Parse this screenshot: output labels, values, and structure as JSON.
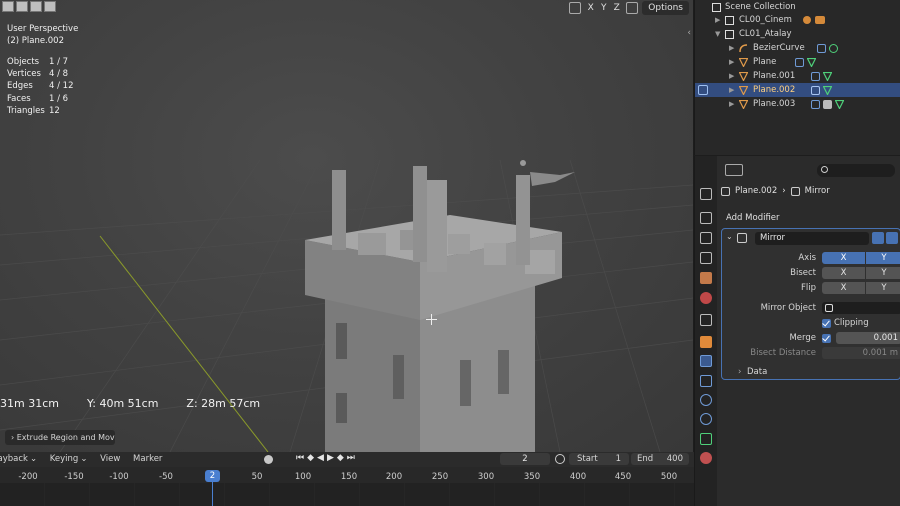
{
  "viewport": {
    "view_name": "User Perspective",
    "object_name": "(2) Plane.002",
    "stats": [
      {
        "label": "Objects",
        "value": "1 / 7"
      },
      {
        "label": "Vertices",
        "value": "4 / 8"
      },
      {
        "label": "Edges",
        "value": "4 / 12"
      },
      {
        "label": "Faces",
        "value": "1 / 6"
      },
      {
        "label": "Triangles",
        "value": "12"
      }
    ],
    "axes": [
      "X",
      "Y",
      "Z"
    ],
    "options_label": "Options",
    "coords": {
      "x": "31m 31cm",
      "y": "Y: 40m 51cm",
      "z": "Z: 28m 57cm"
    },
    "operator_panel": "Extrude Region and Mov"
  },
  "timeline": {
    "menu": [
      "Playback",
      "Keying",
      "View",
      "Marker"
    ],
    "current_frame": "2",
    "start_label": "Start",
    "start_value": "1",
    "end_label": "End",
    "end_value": "400",
    "ticks": [
      "-200",
      "-150",
      "-100",
      "-50",
      "2",
      "50",
      "100",
      "150",
      "200",
      "250",
      "300",
      "350",
      "400",
      "450",
      "500"
    ]
  },
  "outliner": {
    "items": [
      {
        "label": "Scene Collection",
        "icon": "collection-icon"
      },
      {
        "label": "CL00_Cinem",
        "icon": "collection-icon"
      },
      {
        "label": "CL01_Atalay",
        "icon": "collection-icon"
      },
      {
        "label": "BezierCurve",
        "icon": "curve-icon"
      },
      {
        "label": "Plane",
        "icon": "mesh-icon"
      },
      {
        "label": "Plane.001",
        "icon": "mesh-icon"
      },
      {
        "label": "Plane.002",
        "icon": "mesh-icon",
        "selected": true
      },
      {
        "label": "Plane.003",
        "icon": "mesh-icon"
      }
    ]
  },
  "properties": {
    "breadcrumb_object": "Plane.002",
    "breadcrumb_modifier": "Mirror",
    "add_modifier": "Add Modifier",
    "modifier_name": "Mirror",
    "axis_label": "Axis",
    "bisect_label": "Bisect",
    "flip_label": "Flip",
    "x": "X",
    "y": "Y",
    "mirror_object_label": "Mirror Object",
    "clipping_label": "Clipping",
    "merge_label": "Merge",
    "merge_value": "0.001",
    "bisect_distance_label": "Bisect Distance",
    "bisect_distance_value": "0.001 m",
    "data_label": "Data",
    "accent": "#4772b3"
  }
}
